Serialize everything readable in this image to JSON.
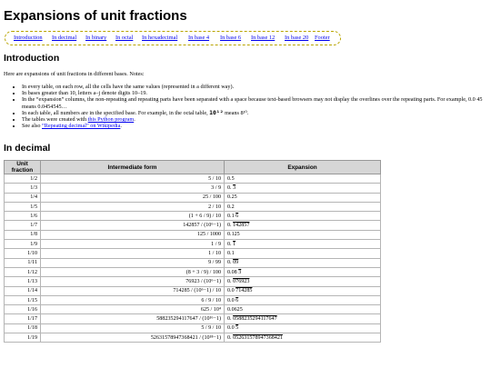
{
  "page": {
    "title": "Expansions of unit fractions"
  },
  "nav": {
    "links": [
      {
        "label": "Introduction"
      },
      {
        "label": "In decimal"
      },
      {
        "label": "In binary"
      },
      {
        "label": "In octal"
      },
      {
        "label": "In hexadecimal"
      },
      {
        "label": "In base 4"
      },
      {
        "label": "In base 6"
      },
      {
        "label": "In base 12"
      },
      {
        "label": "In base 20"
      },
      {
        "label": "Footer"
      }
    ]
  },
  "intro": {
    "heading": "Introduction",
    "lead": "Here are expansions of unit fractions in different bases. Notes:",
    "notes": {
      "n1": "In every table, on each row, all the cells have the same values (represented in a different way).",
      "n2": "In bases greater than 10, letters a–j denote digits 10–19.",
      "n3": "In the “expansion” columns, the non-repeating and repeating parts have been separated with a space because text-based browsers may not display the overlines over the repeating parts. For example, 0.0 45 means 0.0454545…",
      "n4a": "In each table, all numbers are in the specified base. For example, in the octal table, ",
      "n4b": "10¹²",
      "n4c": " means 8¹⁰.",
      "n5a": "The tables were created with ",
      "n5link": "this Python program",
      "n5b": ".",
      "n6a": "See also ",
      "n6link": "“Repeating decimal” on Wikipedia",
      "n6b": "."
    }
  },
  "decimal": {
    "heading": "In decimal",
    "columns": [
      "Unit fraction",
      "Intermediate form",
      "Expansion"
    ],
    "rows": [
      {
        "frac": "1/2",
        "inter": "5 / 10",
        "pre": "0.5",
        "rep": ""
      },
      {
        "frac": "1/3",
        "inter": "3 / 9",
        "pre": "0. ",
        "rep": "3"
      },
      {
        "frac": "1/4",
        "inter": "25 / 100",
        "pre": "0.25",
        "rep": ""
      },
      {
        "frac": "1/5",
        "inter": "2 / 10",
        "pre": "0.2",
        "rep": ""
      },
      {
        "frac": "1/6",
        "inter": "(1 + 6 / 9) / 10",
        "pre": "0.1 ",
        "rep": "6"
      },
      {
        "frac": "1/7",
        "inter": "142857 / (10⁶−1)",
        "pre": "0. ",
        "rep": "142857"
      },
      {
        "frac": "1/8",
        "inter": "125 / 1000",
        "pre": "0.125",
        "rep": ""
      },
      {
        "frac": "1/9",
        "inter": "1 / 9",
        "pre": "0. ",
        "rep": "1"
      },
      {
        "frac": "1/10",
        "inter": "1 / 10",
        "pre": "0.1",
        "rep": ""
      },
      {
        "frac": "1/11",
        "inter": "9 / 99",
        "pre": "0. ",
        "rep": "09"
      },
      {
        "frac": "1/12",
        "inter": "(8 + 3 / 9) / 100",
        "pre": "0.08 ",
        "rep": "3"
      },
      {
        "frac": "1/13",
        "inter": "76923 / (10⁶−1)",
        "pre": "0. ",
        "rep": "076923"
      },
      {
        "frac": "1/14",
        "inter": "714285 / (10⁶−1) / 10",
        "pre": "0.0 ",
        "rep": "714285"
      },
      {
        "frac": "1/15",
        "inter": "6 / 9 / 10",
        "pre": "0.0 ",
        "rep": "6"
      },
      {
        "frac": "1/16",
        "inter": "625 / 10⁴",
        "pre": "0.0625",
        "rep": ""
      },
      {
        "frac": "1/17",
        "inter": "588235294117647 / (10¹⁶−1)",
        "pre": "0. ",
        "rep": "0588235294117647"
      },
      {
        "frac": "1/18",
        "inter": "5 / 9 / 10",
        "pre": "0.0 ",
        "rep": "5"
      },
      {
        "frac": "1/19",
        "inter": "52631578947368421 / (10¹⁸−1)",
        "pre": "0. ",
        "rep": "052631578947368421"
      }
    ]
  }
}
